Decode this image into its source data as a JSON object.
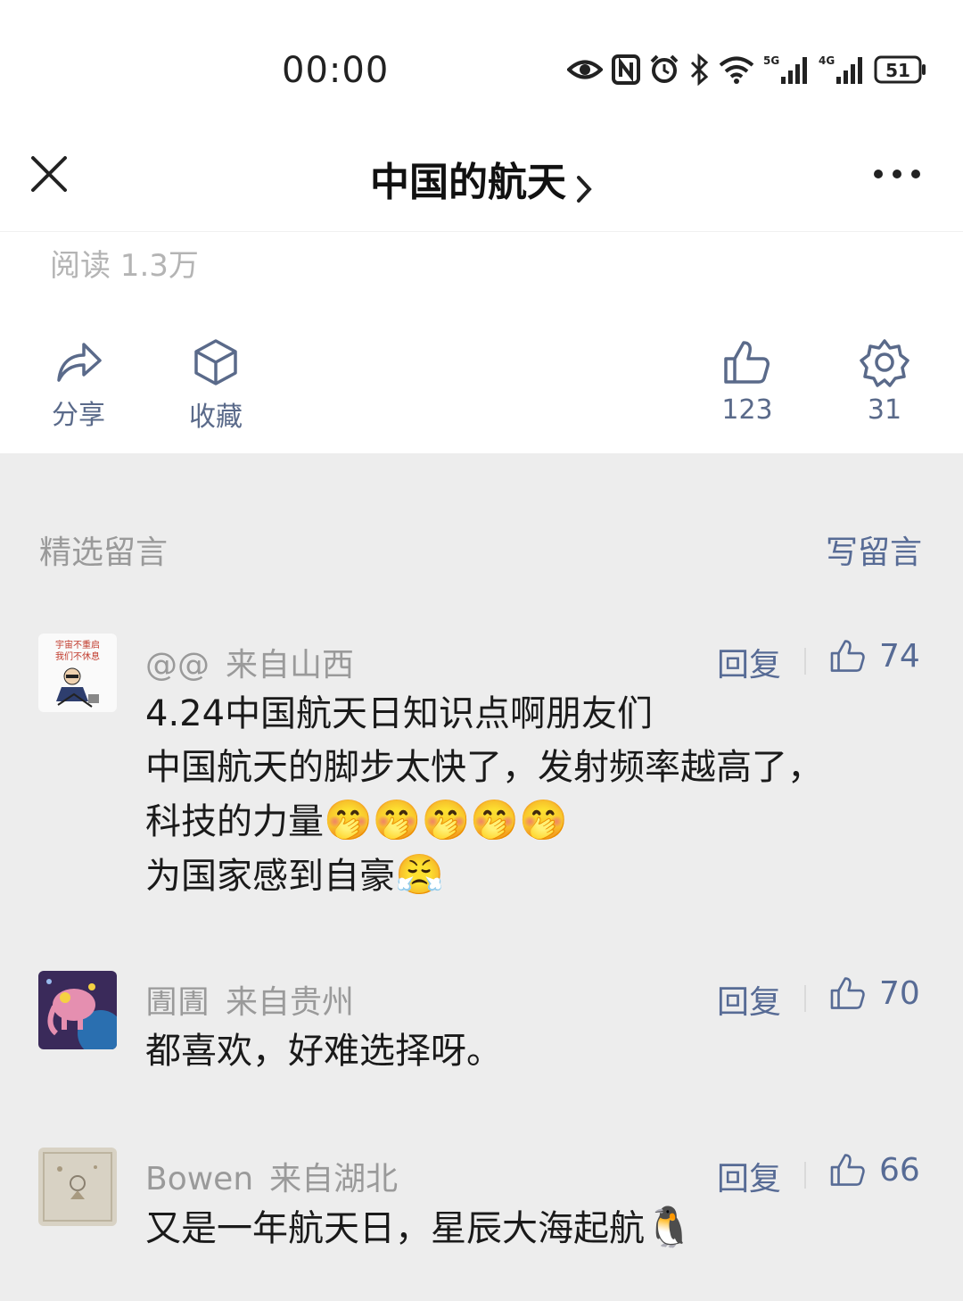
{
  "status_bar": {
    "time": "00:00",
    "battery": "51",
    "net1": "5G",
    "net2": "4G"
  },
  "header": {
    "title": "中国的航天"
  },
  "article": {
    "read_count": "阅读 1.3万",
    "share_label": "分享",
    "favorite_label": "收藏",
    "like_count": "123",
    "wow_count": "31"
  },
  "comments_section": {
    "title": "精选留言",
    "write_label": "写留言"
  },
  "reply_label": "回复",
  "comments": [
    {
      "user": "@@",
      "location": "来自山西",
      "likes": "74",
      "lines": [
        "4.24中国航天日知识点啊朋友们",
        "中国航天的脚步太快了，发射频率越高了，",
        "科技的力量",
        "为国家感到自豪"
      ],
      "emoji_line3": "🤭🤭🤭🤭🤭",
      "emoji_line4": "😤",
      "avatar_text": "宇宙不重启 我们不休息"
    },
    {
      "user": "圊圊",
      "location": "来自贵州",
      "likes": "70",
      "lines": [
        "都喜欢，好难选择呀。"
      ]
    },
    {
      "user": "Bowen",
      "location": "来自湖北",
      "likes": "66",
      "lines": [
        "又是一年航天日，星辰大海起航"
      ],
      "emoji_line1": "🐧"
    }
  ],
  "colors": {
    "link": "#576b95",
    "grey_text": "#9a9a9a",
    "background": "#ededed"
  }
}
